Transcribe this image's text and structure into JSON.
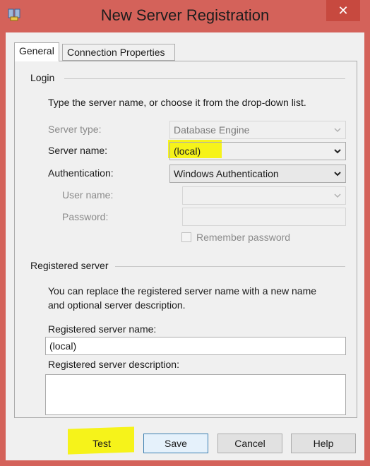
{
  "window": {
    "title": "New Server Registration",
    "close_glyph": "✕"
  },
  "tabs": [
    {
      "label": "General"
    },
    {
      "label": "Connection Properties"
    }
  ],
  "login": {
    "group_label": "Login",
    "instructions": "Type the server name, or choose it from the drop-down list.",
    "server_type": {
      "label": "Server type:",
      "value": "Database Engine"
    },
    "server_name": {
      "label": "Server name:",
      "value": "(local)"
    },
    "authentication": {
      "label": "Authentication:",
      "value": "Windows Authentication"
    },
    "user_name": {
      "label": "User name:",
      "value": ""
    },
    "password": {
      "label": "Password:",
      "value": ""
    },
    "remember_password": {
      "label": "Remember password",
      "checked": false
    }
  },
  "registered": {
    "group_label": "Registered server",
    "description_line1": "You can replace the registered server name with a new name",
    "description_line2": "and optional server description.",
    "name_label": "Registered server name:",
    "name_value": "(local)",
    "desc_label": "Registered server description:",
    "desc_value": ""
  },
  "buttons": {
    "test": "Test",
    "save": "Save",
    "cancel": "Cancel",
    "help": "Help"
  },
  "colors": {
    "highlight": "#f6f31a",
    "frame": "#d4625a",
    "close_bg": "#c7493f"
  }
}
